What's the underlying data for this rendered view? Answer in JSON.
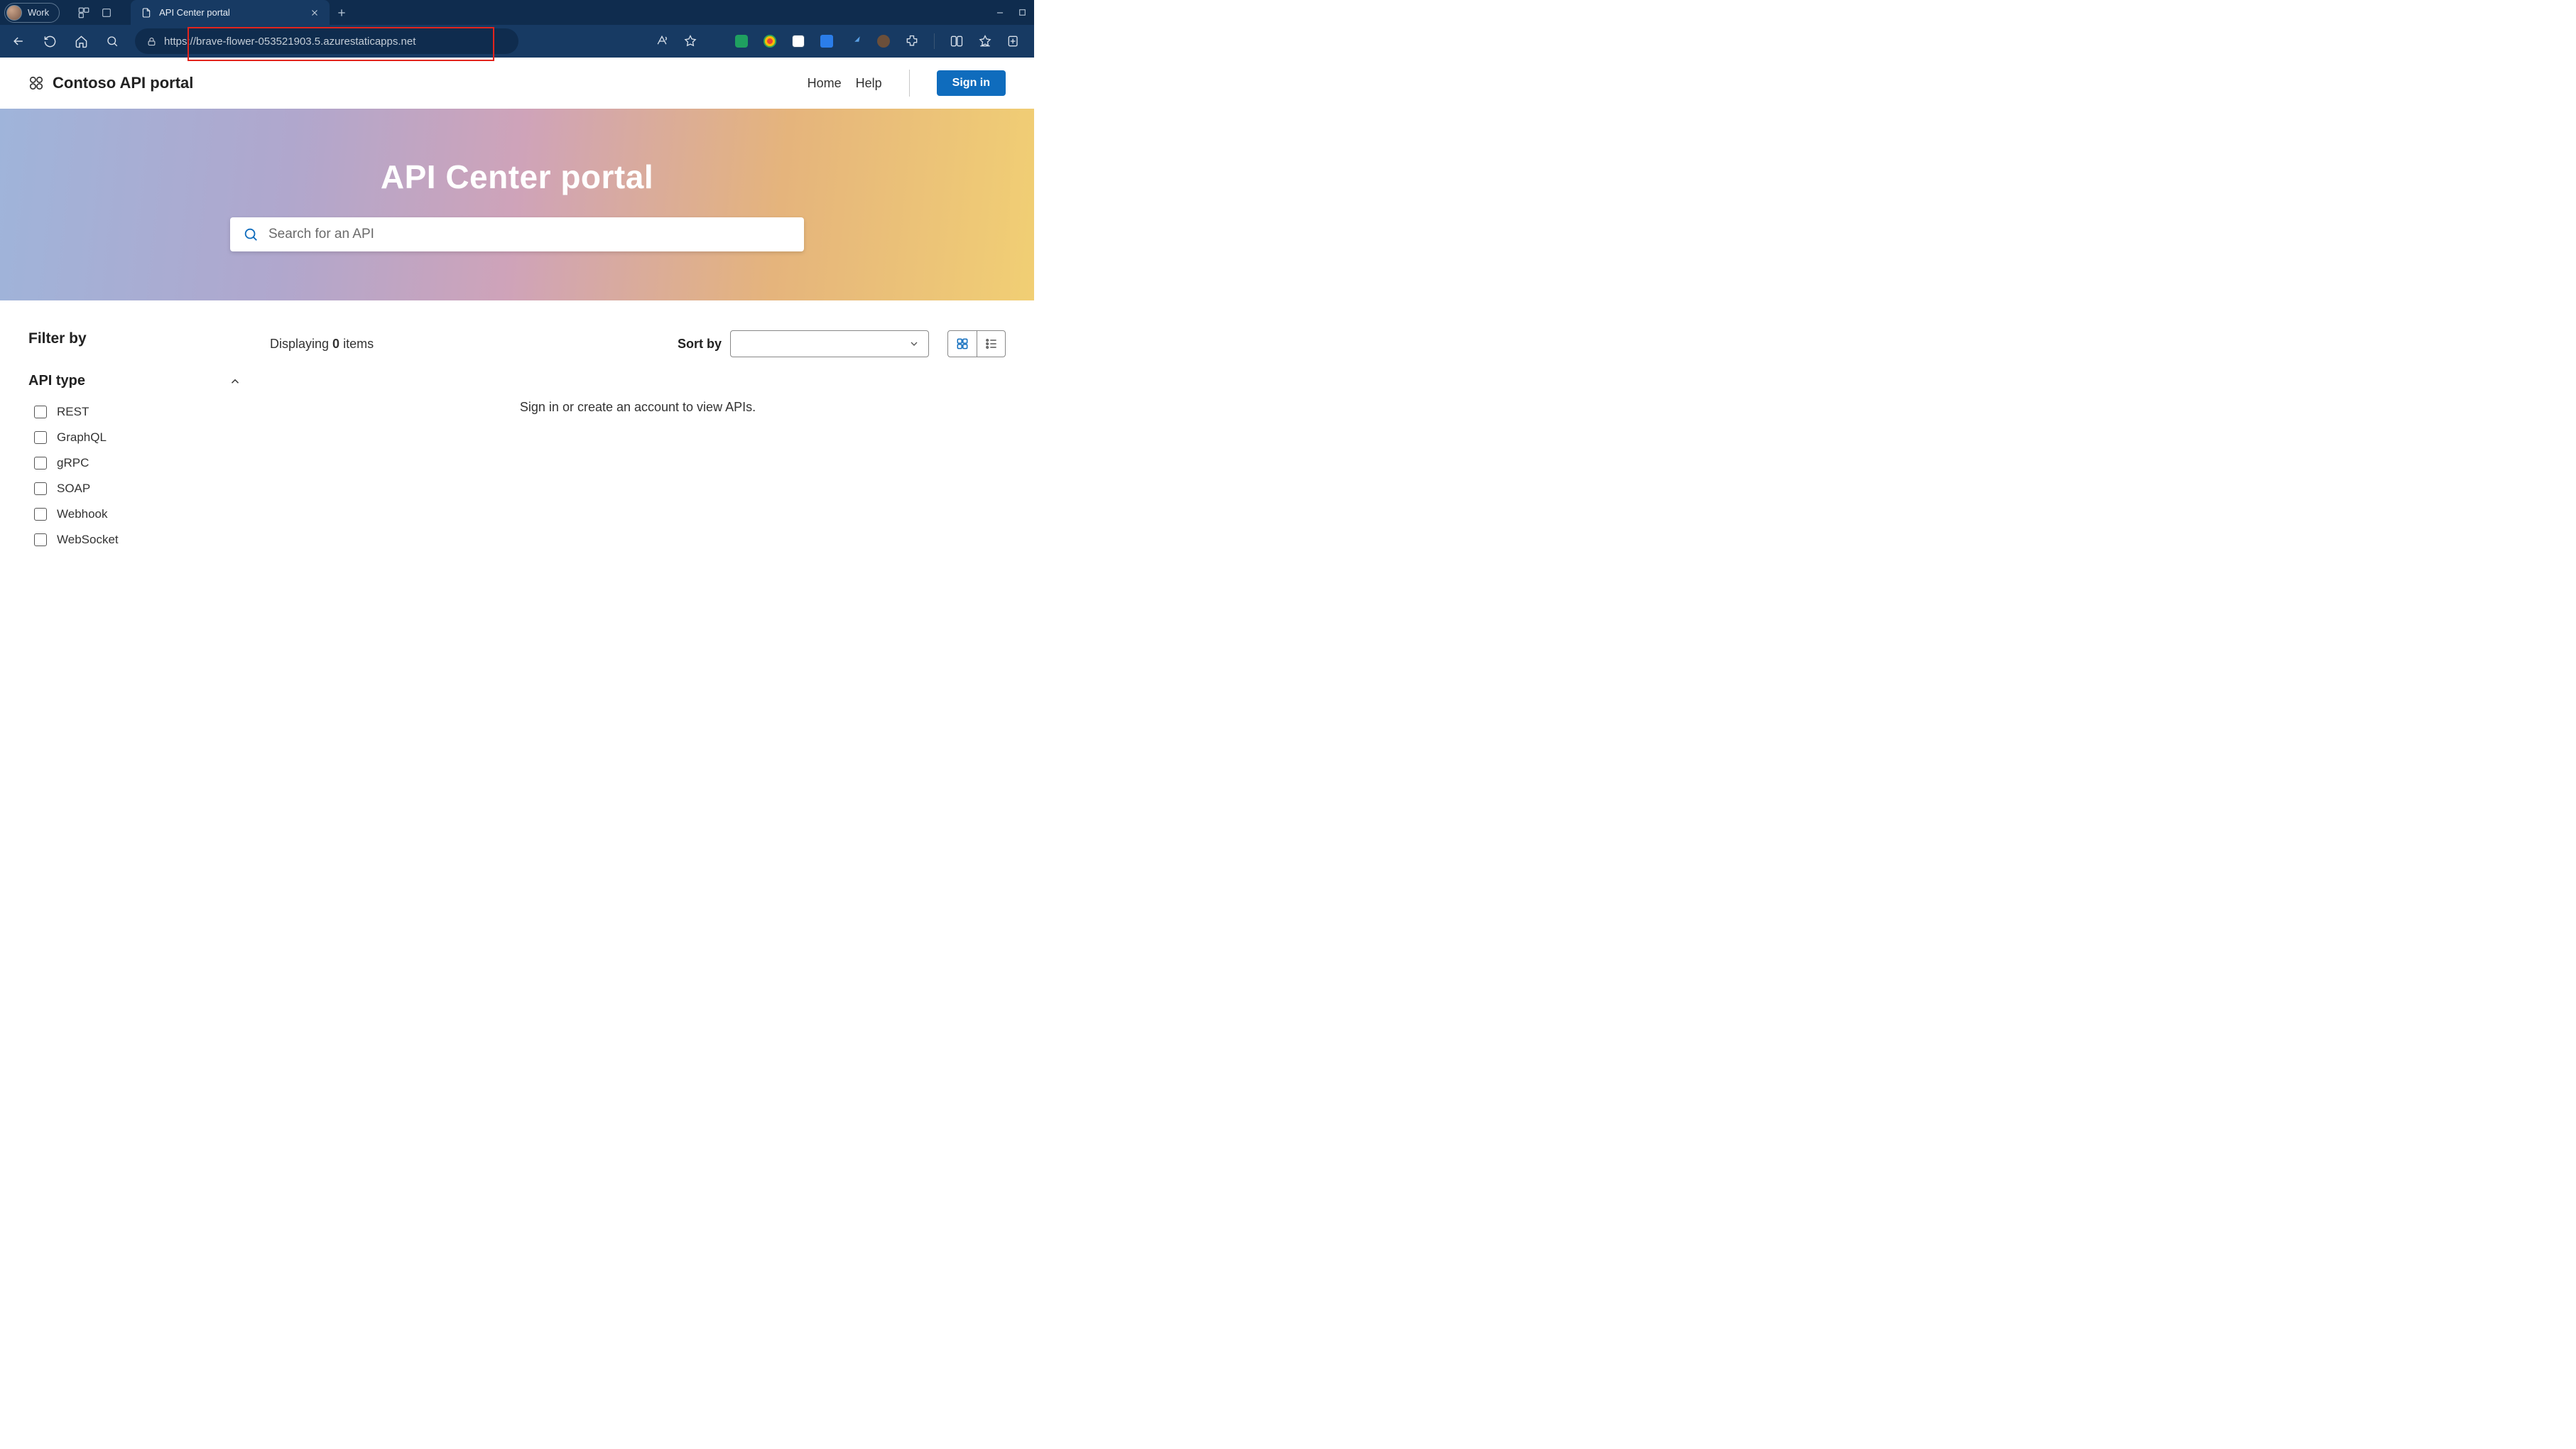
{
  "browser": {
    "profile_label": "Work",
    "tab_title": "API Center portal",
    "url": "https://brave-flower-053521903.5.azurestaticapps.net"
  },
  "header": {
    "brand": "Contoso API portal",
    "nav_home": "Home",
    "nav_help": "Help",
    "signin": "Sign in"
  },
  "hero": {
    "title": "API Center portal",
    "search_placeholder": "Search for an API"
  },
  "sidebar": {
    "filter_title": "Filter by",
    "facet_title": "API type",
    "items": [
      {
        "label": "REST"
      },
      {
        "label": "GraphQL"
      },
      {
        "label": "gRPC"
      },
      {
        "label": "SOAP"
      },
      {
        "label": "Webhook"
      },
      {
        "label": "WebSocket"
      }
    ]
  },
  "results": {
    "displaying_prefix": "Displaying ",
    "count": "0",
    "displaying_suffix": " items",
    "sort_label": "Sort by",
    "empty_message": "Sign in or create an account to view APIs."
  },
  "colors": {
    "accent": "#0f6cbd"
  }
}
